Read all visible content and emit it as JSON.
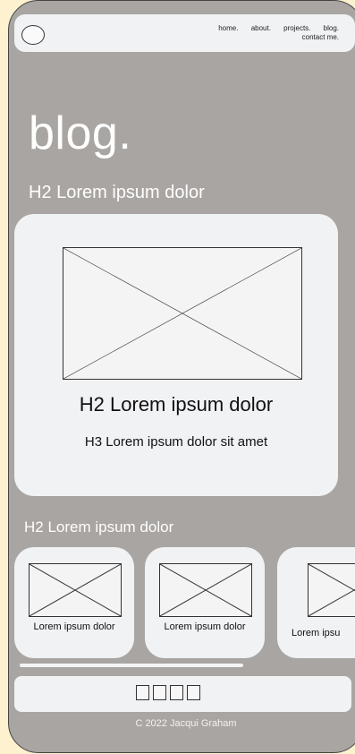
{
  "nav": {
    "links": [
      "home.",
      "about.",
      "projects.",
      "blog.",
      "contact me."
    ]
  },
  "page": {
    "title": "blog.",
    "section_heading_1": "H2 Lorem ipsum dolor",
    "section_heading_2": "H2 Lorem ipsum dolor"
  },
  "feature": {
    "heading": "H2 Lorem ipsum dolor",
    "subheading": "H3 Lorem ipsum dolor sit amet"
  },
  "cards": [
    {
      "label": "Lorem ipsum dolor"
    },
    {
      "label": "Lorem ipsum dolor"
    },
    {
      "label": "Lorem ipsu"
    }
  ],
  "footer": {
    "copyright": "C 2022 Jacqui Graham",
    "icons": [
      "social-icon-1",
      "social-icon-2",
      "social-icon-3",
      "social-icon-4"
    ]
  },
  "colors": {
    "background": "#a9a5a2",
    "surface": "#f1f2f4",
    "page_outer": "#fdf1cf"
  }
}
